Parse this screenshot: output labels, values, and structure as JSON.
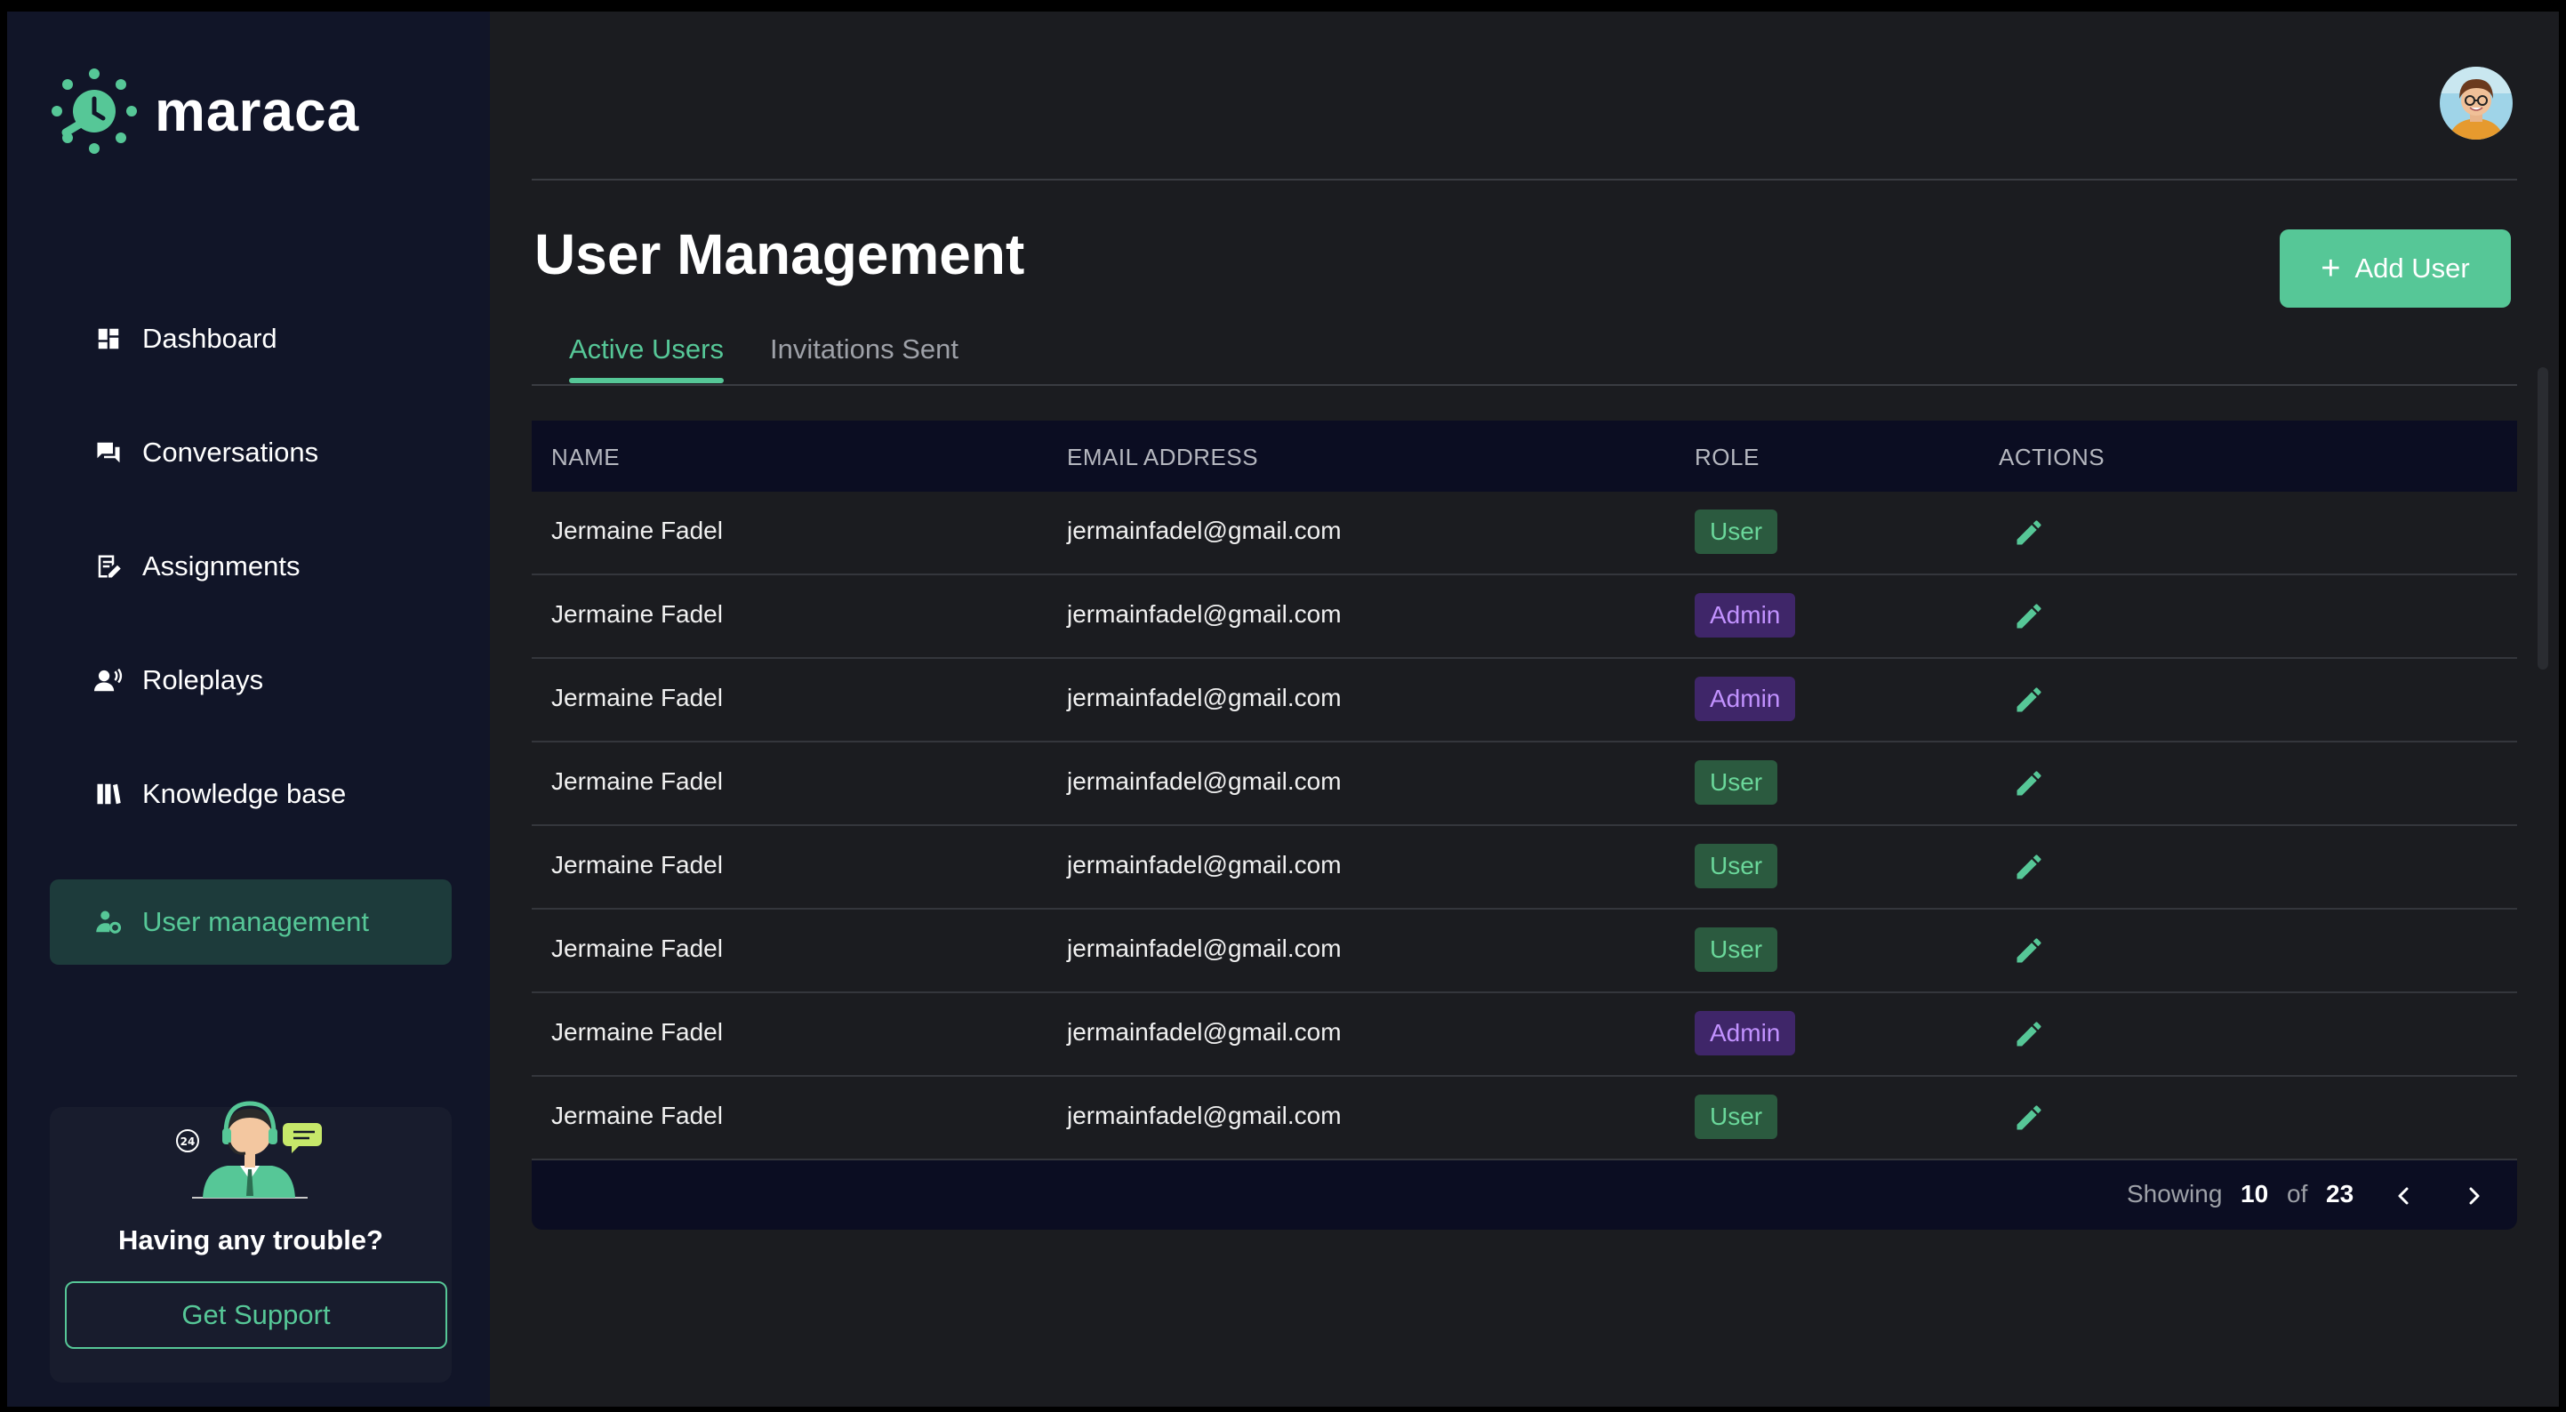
{
  "app": {
    "name": "maraca"
  },
  "sidebar": {
    "items": [
      {
        "label": "Dashboard",
        "icon": "dashboard-icon"
      },
      {
        "label": "Conversations",
        "icon": "chat-icon"
      },
      {
        "label": "Assignments",
        "icon": "assignment-icon"
      },
      {
        "label": "Roleplays",
        "icon": "roleplay-icon"
      },
      {
        "label": "Knowledge base",
        "icon": "book-icon"
      },
      {
        "label": "User management",
        "icon": "user-gear-icon",
        "active": true
      }
    ]
  },
  "support": {
    "title": "Having any trouble?",
    "button": "Get Support"
  },
  "page": {
    "title": "User Management",
    "add_button": "Add User",
    "tabs": [
      {
        "label": "Active Users",
        "active": true
      },
      {
        "label": "Invitations Sent"
      }
    ]
  },
  "table": {
    "columns": [
      "NAME",
      "EMAIL ADDRESS",
      "ROLE",
      "ACTIONS"
    ],
    "rows": [
      {
        "name": "Jermaine Fadel",
        "email": "jermainfadel@gmail.com",
        "role": "User"
      },
      {
        "name": "Jermaine Fadel",
        "email": "jermainfadel@gmail.com",
        "role": "Admin"
      },
      {
        "name": "Jermaine Fadel",
        "email": "jermainfadel@gmail.com",
        "role": "Admin"
      },
      {
        "name": "Jermaine Fadel",
        "email": "jermainfadel@gmail.com",
        "role": "User"
      },
      {
        "name": "Jermaine Fadel",
        "email": "jermainfadel@gmail.com",
        "role": "User"
      },
      {
        "name": "Jermaine Fadel",
        "email": "jermainfadel@gmail.com",
        "role": "User"
      },
      {
        "name": "Jermaine Fadel",
        "email": "jermainfadel@gmail.com",
        "role": "Admin"
      },
      {
        "name": "Jermaine Fadel",
        "email": "jermainfadel@gmail.com",
        "role": "User"
      }
    ]
  },
  "pagination": {
    "showing_label": "Showing",
    "shown": "10",
    "of_label": "of",
    "total": "23"
  },
  "colors": {
    "accent": "#56c797",
    "user_badge": "#2b5a3f",
    "admin_badge": "#3f2669",
    "sidebar_bg": "#111528"
  }
}
